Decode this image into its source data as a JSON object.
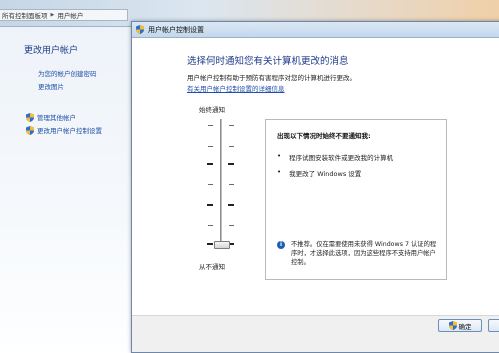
{
  "control_panel": {
    "breadcrumb": [
      "所有控制面板项",
      "用户帐户"
    ],
    "left_title": "更改用户帐户",
    "links": [
      "为您的帐户创建密码",
      "更改图片"
    ],
    "icon_links": [
      "管理其他帐户",
      "更改用户帐户控制设置"
    ]
  },
  "dialog": {
    "title": "用户帐户控制设置",
    "heading": "选择何时通知您有关计算机更改的消息",
    "description": "用户帐户控制有助于预防有害程序对您的计算机进行更改。",
    "help_link": "有关用户帐户控制设置的详细信息",
    "slider": {
      "top_label": "始终通知",
      "bottom_label": "从不通知",
      "level": 0,
      "levels": 4
    },
    "info": {
      "title": "出现以下情况时始终不要通知我:",
      "bullets": [
        "程序试图安装软件或更改我的计算机",
        "我更改了 Windows 设置"
      ],
      "note": "不推荐。仅在需要使用未获得 Windows 7 认证的程序时，才选择此选项，因为这些程序不支持用户帐户控制。"
    },
    "buttons": {
      "ok": "确定"
    }
  },
  "colors": {
    "link": "#1f4fa8",
    "heading": "#1e3a8a",
    "shield_blue": "#2f6bd0",
    "shield_yellow": "#f2c12e"
  },
  "icons": [
    "uac-shield-icon",
    "info-icon",
    "chevron-right-icon"
  ]
}
